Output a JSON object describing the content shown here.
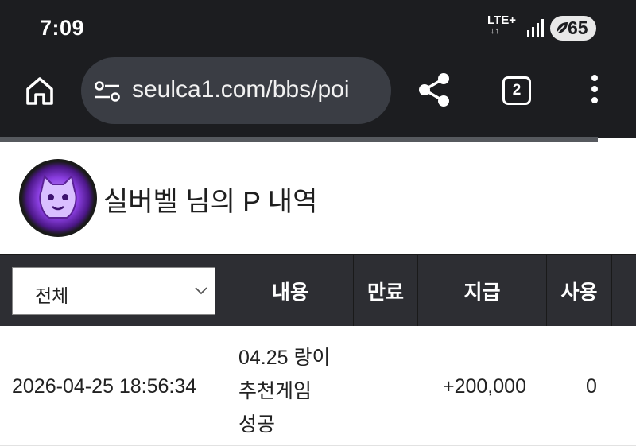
{
  "status_bar": {
    "time": "7:09",
    "network": "LTE+",
    "network_arrows": "↓↑",
    "battery": "65"
  },
  "browser": {
    "url": "seulca1.com/bbs/poi",
    "tab_count": "2"
  },
  "profile": {
    "title": "실버벨 님의 P 내역"
  },
  "table": {
    "filter": {
      "selected": "전체"
    },
    "headers": [
      "내용",
      "만료",
      "지급",
      "사용"
    ],
    "rows": [
      {
        "date": "2026-04-25 18:56:34",
        "content": "04.25 랑이 추천게임 성공",
        "expire": "",
        "pay": "+200,000",
        "use": "0"
      }
    ]
  },
  "colors": {
    "chrome": "#1c1d20",
    "url_bar": "#3a3d44",
    "table_header": "#2d2e33"
  }
}
